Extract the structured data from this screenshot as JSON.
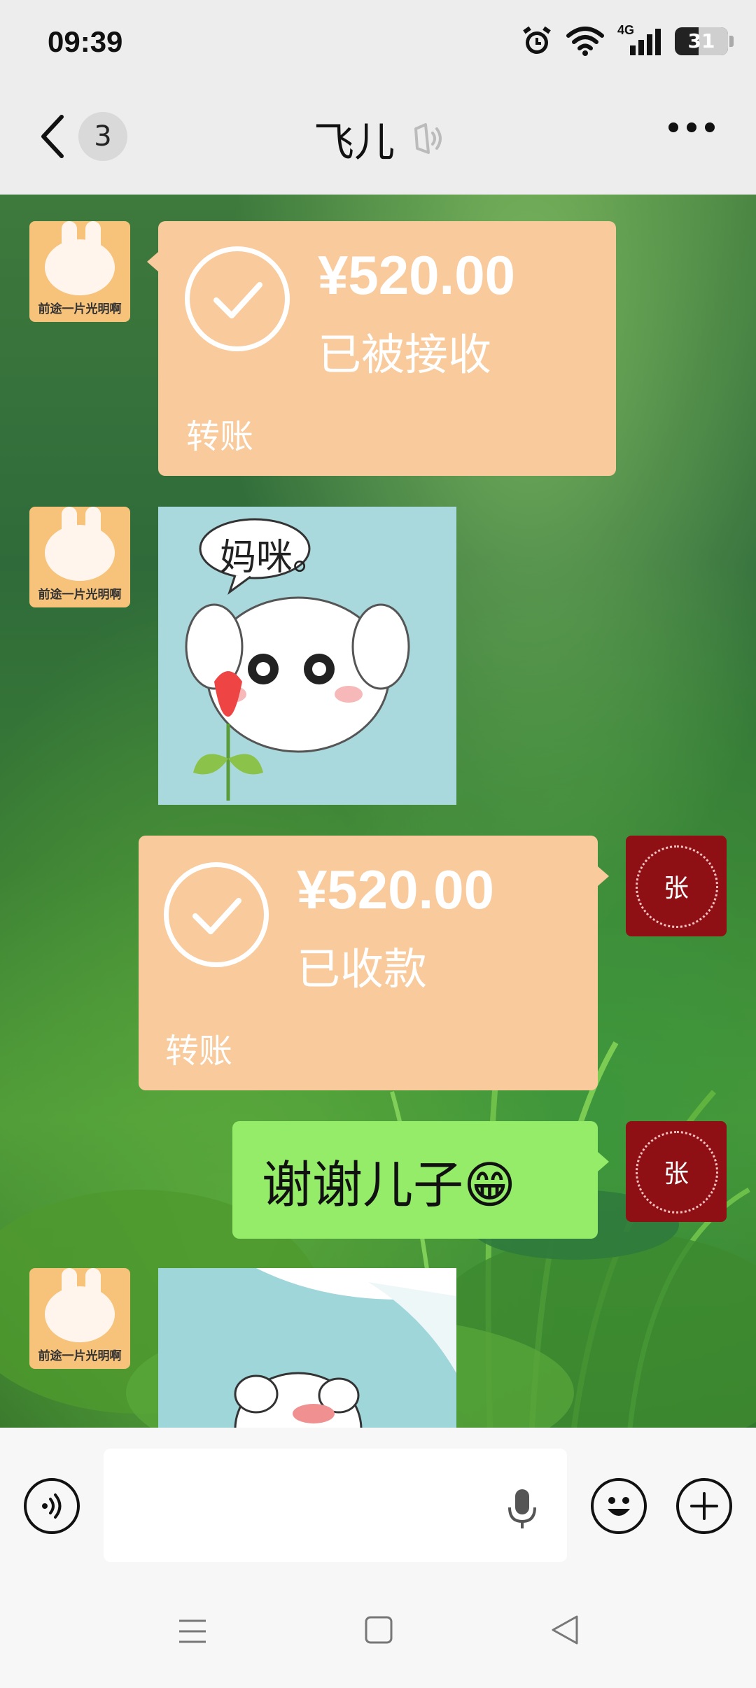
{
  "status_bar": {
    "time": "09:39",
    "network": "4G",
    "battery": "31",
    "icons": [
      "alarm-icon",
      "wifi-icon",
      "signal-icon",
      "battery-icon"
    ]
  },
  "nav": {
    "back_icon": "chevron-left-icon",
    "unread_count": "3",
    "title": "飞儿",
    "mute_icon": "sound-off-icon",
    "more_icon": "ellipsis-icon"
  },
  "messages": [
    {
      "sender": "other",
      "type": "transfer",
      "amount": "¥520.00",
      "status": "已被接收",
      "label": "转账",
      "avatar_caption": "前途一片光明啊"
    },
    {
      "sender": "other",
      "type": "sticker",
      "sticker_text": "妈咪。",
      "avatar_caption": "前途一片光明啊"
    },
    {
      "sender": "self",
      "type": "transfer",
      "amount": "¥520.00",
      "status": "已收款",
      "label": "转账",
      "avatar_text": "张"
    },
    {
      "sender": "self",
      "type": "text",
      "text": "谢谢儿子😁",
      "avatar_text": "张"
    },
    {
      "sender": "other",
      "type": "sticker",
      "sticker_text": "",
      "avatar_caption": "前途一片光明啊"
    }
  ],
  "input_bar": {
    "voice_icon": "voice-mode-icon",
    "mic_icon": "microphone-icon",
    "emoji_icon": "emoji-icon",
    "plus_icon": "plus-icon",
    "placeholder": ""
  },
  "system_nav": {
    "menu_icon": "menu-icon",
    "home_icon": "home-square-icon",
    "back_icon": "back-triangle-icon"
  },
  "colors": {
    "transfer_bubble": "#f8ca9c",
    "text_bubble": "#95ec69",
    "bar_bg": "#ededed"
  }
}
